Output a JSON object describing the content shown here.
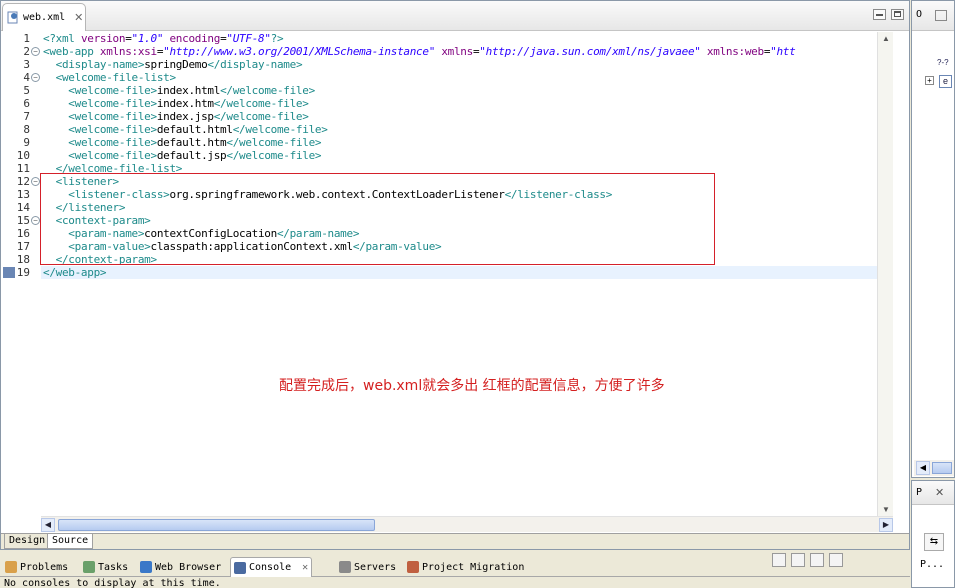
{
  "editor": {
    "file_tab": "web.xml",
    "lines": [
      {
        "n": "1",
        "parts": [
          [
            "tag",
            "<?xml "
          ],
          [
            "attr",
            "version"
          ],
          [
            "txt",
            "="
          ],
          [
            "str",
            "\"1.0\""
          ],
          [
            "txt",
            " "
          ],
          [
            "attr",
            "encoding"
          ],
          [
            "txt",
            "="
          ],
          [
            "str",
            "\"UTF-8\""
          ],
          [
            "tag",
            "?>"
          ]
        ]
      },
      {
        "n": "2",
        "parts": [
          [
            "tag",
            "<web-app "
          ],
          [
            "attr",
            "xmlns:xsi"
          ],
          [
            "txt",
            "="
          ],
          [
            "str",
            "\"http://www.w3.org/2001/XMLSchema-instance\""
          ],
          [
            "txt",
            " "
          ],
          [
            "attr",
            "xmlns"
          ],
          [
            "txt",
            "="
          ],
          [
            "str",
            "\"http://java.sun.com/xml/ns/javaee\""
          ],
          [
            "txt",
            " "
          ],
          [
            "attr",
            "xmlns:web"
          ],
          [
            "txt",
            "="
          ],
          [
            "str",
            "\"htt"
          ]
        ]
      },
      {
        "n": "3",
        "parts": [
          [
            "txt",
            "  "
          ],
          [
            "tag",
            "<display-name>"
          ],
          [
            "txt",
            "springDemo"
          ],
          [
            "tag",
            "</display-name>"
          ]
        ]
      },
      {
        "n": "4",
        "parts": [
          [
            "txt",
            "  "
          ],
          [
            "tag",
            "<welcome-file-list>"
          ]
        ]
      },
      {
        "n": "5",
        "parts": [
          [
            "txt",
            "    "
          ],
          [
            "tag",
            "<welcome-file>"
          ],
          [
            "txt",
            "index.html"
          ],
          [
            "tag",
            "</welcome-file>"
          ]
        ]
      },
      {
        "n": "6",
        "parts": [
          [
            "txt",
            "    "
          ],
          [
            "tag",
            "<welcome-file>"
          ],
          [
            "txt",
            "index.htm"
          ],
          [
            "tag",
            "</welcome-file>"
          ]
        ]
      },
      {
        "n": "7",
        "parts": [
          [
            "txt",
            "    "
          ],
          [
            "tag",
            "<welcome-file>"
          ],
          [
            "txt",
            "index.jsp"
          ],
          [
            "tag",
            "</welcome-file>"
          ]
        ]
      },
      {
        "n": "8",
        "parts": [
          [
            "txt",
            "    "
          ],
          [
            "tag",
            "<welcome-file>"
          ],
          [
            "txt",
            "default.html"
          ],
          [
            "tag",
            "</welcome-file>"
          ]
        ]
      },
      {
        "n": "9",
        "parts": [
          [
            "txt",
            "    "
          ],
          [
            "tag",
            "<welcome-file>"
          ],
          [
            "txt",
            "default.htm"
          ],
          [
            "tag",
            "</welcome-file>"
          ]
        ]
      },
      {
        "n": "10",
        "parts": [
          [
            "txt",
            "    "
          ],
          [
            "tag",
            "<welcome-file>"
          ],
          [
            "txt",
            "default.jsp"
          ],
          [
            "tag",
            "</welcome-file>"
          ]
        ]
      },
      {
        "n": "11",
        "parts": [
          [
            "txt",
            "  "
          ],
          [
            "tag",
            "</welcome-file-list>"
          ]
        ]
      },
      {
        "n": "12",
        "parts": [
          [
            "txt",
            "  "
          ],
          [
            "tag",
            "<listener>"
          ]
        ]
      },
      {
        "n": "13",
        "parts": [
          [
            "txt",
            "    "
          ],
          [
            "tag",
            "<listener-class>"
          ],
          [
            "txt",
            "org.springframework.web.context.ContextLoaderListener"
          ],
          [
            "tag",
            "</listener-class>"
          ]
        ]
      },
      {
        "n": "14",
        "parts": [
          [
            "txt",
            "  "
          ],
          [
            "tag",
            "</listener>"
          ]
        ]
      },
      {
        "n": "15",
        "parts": [
          [
            "txt",
            "  "
          ],
          [
            "tag",
            "<context-param>"
          ]
        ]
      },
      {
        "n": "16",
        "parts": [
          [
            "txt",
            "    "
          ],
          [
            "tag",
            "<param-name>"
          ],
          [
            "txt",
            "contextConfigLocation"
          ],
          [
            "tag",
            "</param-name>"
          ]
        ]
      },
      {
        "n": "17",
        "parts": [
          [
            "txt",
            "    "
          ],
          [
            "tag",
            "<param-value>"
          ],
          [
            "txt",
            "classpath:applicationContext.xml"
          ],
          [
            "tag",
            "</param-value>"
          ]
        ]
      },
      {
        "n": "18",
        "parts": [
          [
            "txt",
            "  "
          ],
          [
            "tag",
            "</context-param>"
          ]
        ]
      },
      {
        "n": "19",
        "parts": [
          [
            "tag",
            "</web-app>"
          ]
        ]
      }
    ],
    "fold_lines": [
      2,
      4,
      12,
      15
    ],
    "annotation": "配置完成后，web.xml就会多出 红框的配置信息，方便了许多",
    "mode_tabs": {
      "design": "Design",
      "source": "Source"
    }
  },
  "outline": {
    "tab": "O",
    "toolbar_icon": "?-?",
    "node_label": "e"
  },
  "properties": {
    "tab": "P",
    "label": "P..."
  },
  "bottom": {
    "tabs": [
      {
        "label": "Problems",
        "icon": "problems-icon",
        "color": "#d9a04a"
      },
      {
        "label": "Tasks",
        "icon": "tasks-icon",
        "color": "#6aa06a"
      },
      {
        "label": "Web Browser",
        "icon": "globe-icon",
        "color": "#3a78c8"
      },
      {
        "label": "Console",
        "icon": "console-icon",
        "color": "#4a6aa0"
      },
      {
        "label": "Servers",
        "icon": "servers-icon",
        "color": "#8a8a8a"
      },
      {
        "label": "Project Migration",
        "icon": "migration-icon",
        "color": "#c06040"
      }
    ],
    "console_message": "No consoles to display at this time."
  },
  "colors": {
    "highlight_box": "#d4202a",
    "annotation": "#d42020",
    "tag": "#1d8a8a",
    "attr": "#7f007f",
    "string": "#2a00ff"
  }
}
